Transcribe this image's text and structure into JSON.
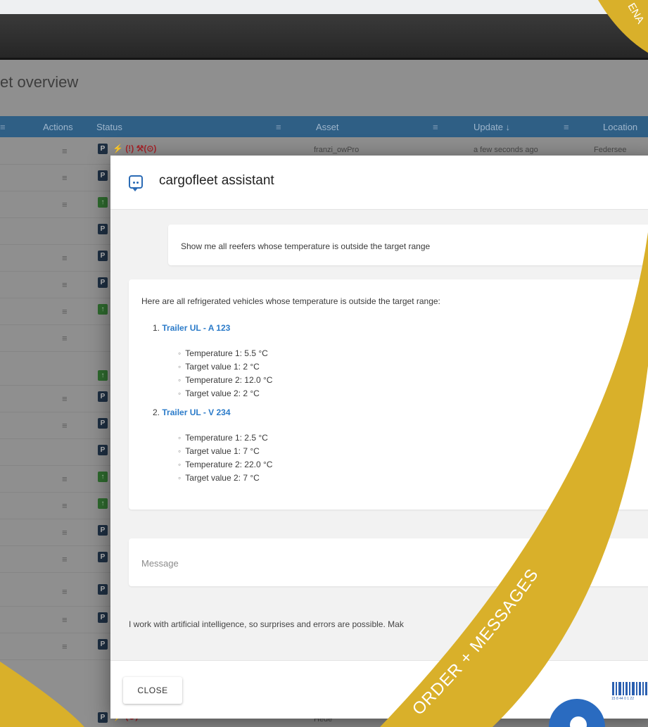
{
  "page": {
    "title": "et overview"
  },
  "table": {
    "columns": [
      "Actions",
      "Status",
      "Asset",
      "Update ↓",
      "Location"
    ],
    "first_row": {
      "asset": "franzi_owPro",
      "update": "a few seconds ago",
      "location": "Federsee"
    },
    "last_row": {
      "asset": "Hede"
    }
  },
  "assistant": {
    "title": "cargofleet assistant",
    "user_message": "Show me all reefers whose temperature is outside the target range",
    "reply_intro": "Here are all refrigerated vehicles whose temperature is outside the target range:",
    "results": [
      {
        "number": "1.",
        "name": "Trailer UL - A 123",
        "details": [
          "Temperature 1: 5.5 °C",
          "Target value 1: 2 °C",
          "Temperature 2: 12.0 °C",
          "Target value 2: 2 °C"
        ]
      },
      {
        "number": "2.",
        "name": "Trailer UL - V 234",
        "details": [
          "Temperature 1: 2.5 °C",
          "Target value 1: 7 °C",
          "Temperature 2: 22.0 °C",
          "Target value 2: 7 °C"
        ]
      }
    ],
    "input_placeholder": "Message",
    "disclaimer": "I work with artificial intelligence, so surprises and errors are possible. Mak",
    "close_label": "CLOSE"
  },
  "banner": {
    "text": "ORDER + MESSAGES",
    "corner_text": "ENA",
    "barcode_digits": "15 8 44 0 1 22",
    "color": "#d9b02a"
  },
  "colors": {
    "table_header": "#2f5f85",
    "link": "#2b7bc9",
    "parked_badge": "#1e2f42",
    "moving_badge": "#2e6a2e",
    "alert_icon": "#a8262c"
  }
}
